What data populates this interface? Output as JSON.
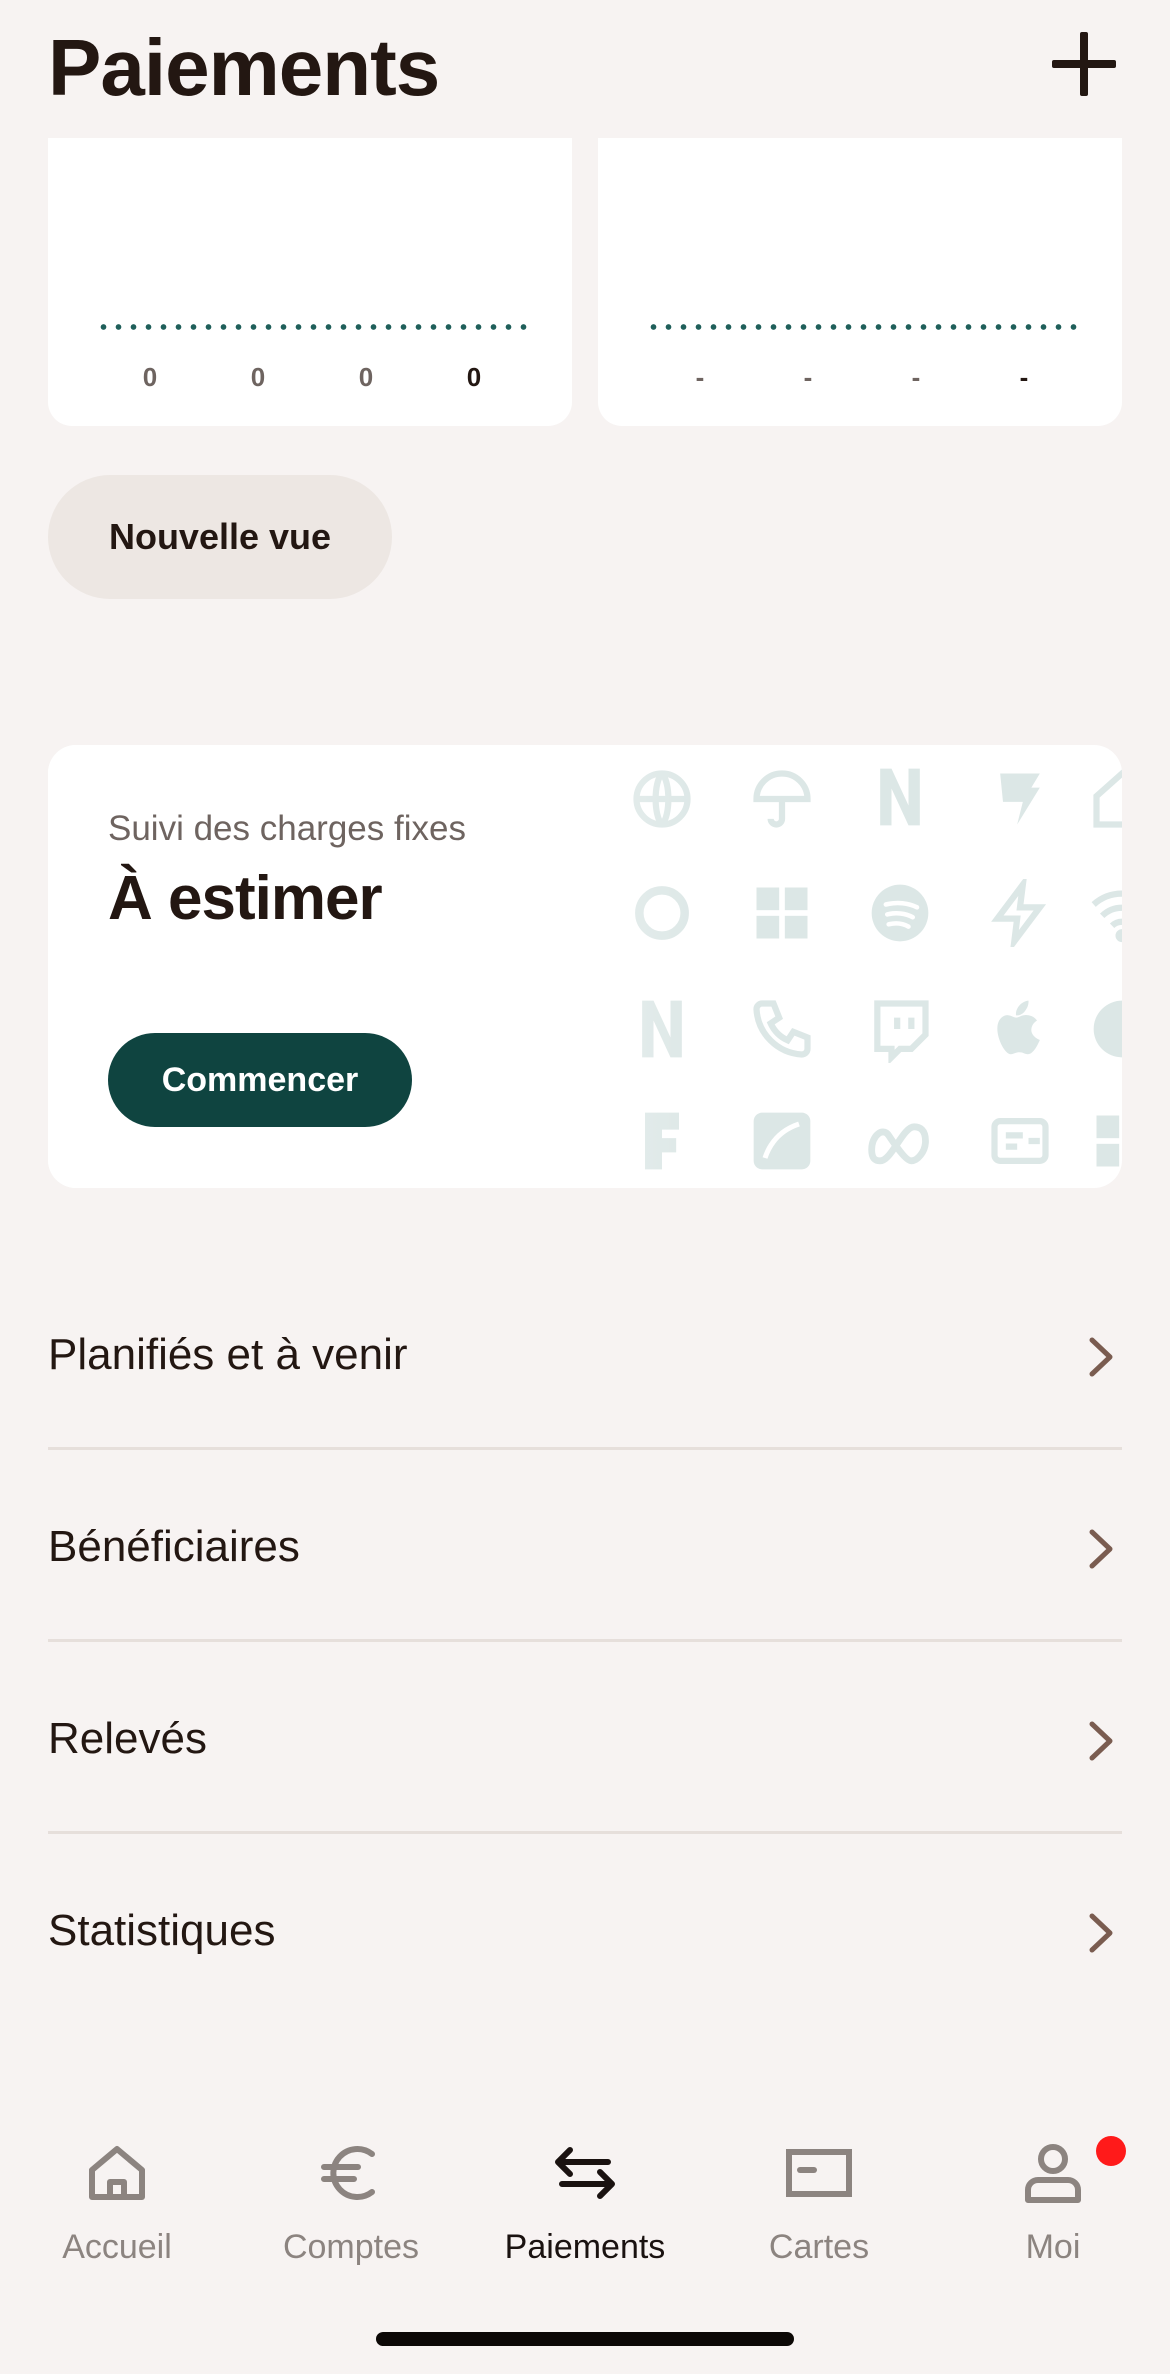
{
  "header": {
    "title": "Paiements",
    "add_icon": "plus-icon"
  },
  "chart_cards": [
    {
      "ticks": [
        "0",
        "0",
        "0",
        "0"
      ],
      "current_index": 3
    },
    {
      "ticks": [
        "-",
        "-",
        "-",
        "-"
      ],
      "current_index": 3
    }
  ],
  "new_view": {
    "label": "Nouvelle vue"
  },
  "fixed_charges": {
    "subtitle": "Suivi des charges fixes",
    "title": "À estimer",
    "button": "Commencer",
    "accent_color": "#0f4440"
  },
  "menu": [
    {
      "label": "Planifiés et à venir",
      "icon": "chevron-right-icon"
    },
    {
      "label": "Bénéficiaires",
      "icon": "chevron-right-icon"
    },
    {
      "label": "Relevés",
      "icon": "chevron-right-icon"
    },
    {
      "label": "Statistiques",
      "icon": "chevron-right-icon"
    }
  ],
  "bottom_nav": {
    "items": [
      {
        "label": "Accueil",
        "icon": "home-icon"
      },
      {
        "label": "Comptes",
        "icon": "euro-icon"
      },
      {
        "label": "Paiements",
        "icon": "transfer-arrows-icon",
        "active": true
      },
      {
        "label": "Cartes",
        "icon": "card-icon"
      },
      {
        "label": "Moi",
        "icon": "person-icon",
        "badge": "notification-dot"
      }
    ]
  },
  "colors": {
    "background": "#f7f3f2",
    "text": "#231712",
    "muted": "#8c8480",
    "chevron": "#7a5c50",
    "badge": "#ff1a1a"
  }
}
